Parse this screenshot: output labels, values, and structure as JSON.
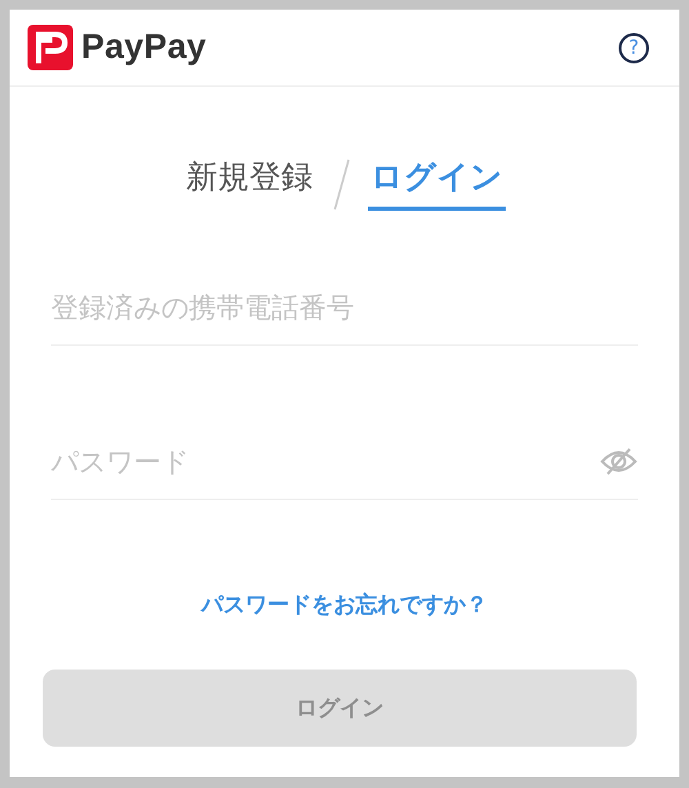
{
  "header": {
    "brand": "PayPay",
    "help": "?"
  },
  "tabs": [
    {
      "label": "新規登録",
      "selected": false
    },
    {
      "label": "ログイン",
      "selected": true
    }
  ],
  "fields": [
    {
      "kind": "phone",
      "placeholder": "登録済みの携帯電話番号"
    },
    {
      "kind": "password",
      "placeholder": "パスワード",
      "revealed": false
    }
  ],
  "forgot_link": "パスワードをお忘れですか？",
  "submit": {
    "label": "ログイン",
    "disabled": true
  }
}
